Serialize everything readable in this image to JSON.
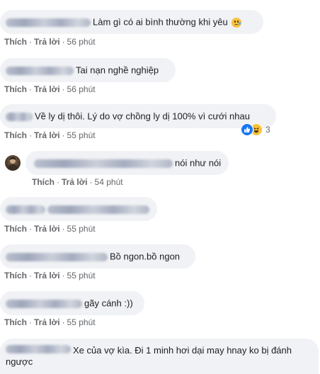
{
  "comments": [
    {
      "text": "Làm gì có ai bình thường khi yêu",
      "emoji": "sad-tear-emoji",
      "like_label": "Thích",
      "reply_label": "Trả lời",
      "time": "56 phút"
    },
    {
      "text": "Tai nạn nghề nghiệp",
      "like_label": "Thích",
      "reply_label": "Trả lời",
      "time": "56 phút"
    },
    {
      "text": "Về ly dị thôi. Lý do vợ chồng ly dị 100% vì cưới nhau",
      "like_label": "Thích",
      "reply_label": "Trả lời",
      "time": "55 phút",
      "reactions": {
        "icons": [
          "like-icon",
          "haha-icon"
        ],
        "count": "3"
      }
    },
    {
      "text": "nói như nói",
      "like_label": "Thích",
      "reply_label": "Trả lời",
      "time": "54 phút",
      "has_avatar": true
    },
    {
      "text": "",
      "like_label": "Thích",
      "reply_label": "Trả lời",
      "time": "55 phút"
    },
    {
      "text": "Bồ ngon.bồ ngon",
      "like_label": "Thích",
      "reply_label": "Trả lời",
      "time": "55 phút"
    },
    {
      "text": "gãy cánh :))",
      "like_label": "Thích",
      "reply_label": "Trả lời",
      "time": "55 phút"
    },
    {
      "text": "Xe của vợ kìa. Đi 1 minh hơi dại may hnay ko bị đánh ngược",
      "like_label": "",
      "reply_label": "",
      "time": ""
    }
  ],
  "colors": {
    "bubble_bg": "#f0f2f5",
    "text": "#1c1e21",
    "meta": "#65676b",
    "like_blue": "#1877f2",
    "haha_yellow": "#f7c23c"
  }
}
